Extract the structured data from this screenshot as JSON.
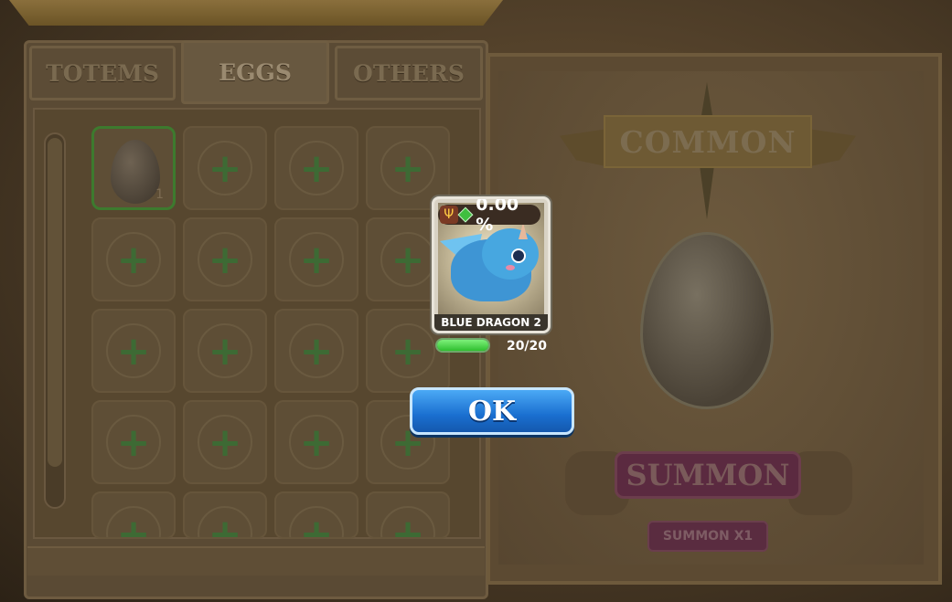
{
  "tabs": [
    {
      "label": "TOTEMS",
      "active": false
    },
    {
      "label": "EGGS",
      "active": true
    },
    {
      "label": "OTHERS",
      "active": false
    }
  ],
  "inventory": {
    "first_slot": {
      "item": "egg",
      "count": "1"
    },
    "empty_slot_icon": "plus-icon"
  },
  "summon_panel": {
    "rarity_banner": "COMMON",
    "summon_button": "SUMMON",
    "summon_x1_button": "SUMMON X1"
  },
  "popup": {
    "percent": "0.00 %",
    "card_name": "BLUE DRAGON 2",
    "progress_text": "20/20",
    "progress_fraction": 1.0,
    "ok_button": "OK",
    "icons": [
      "trident-icon",
      "gem-icon"
    ]
  },
  "colors": {
    "ok_button": "#1a6fd0",
    "progress_fill": "#2fbf2f",
    "summon_button": "#5b2a40"
  }
}
